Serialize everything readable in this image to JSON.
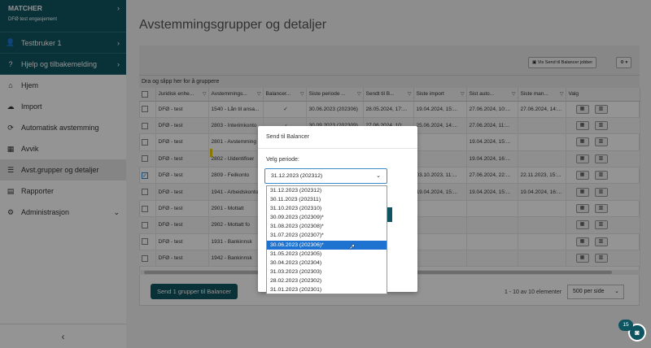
{
  "sidebar": {
    "brand_title": "MATCHER",
    "brand_subtitle": "DFØ test engasjement",
    "user": "Testbruker 1",
    "help": "Hjelp og tilbakemelding",
    "menu": [
      "Hjem",
      "Import",
      "Automatisk avstemming",
      "Avvik",
      "Avst.grupper og detaljer",
      "Rapporter",
      "Administrasjon"
    ],
    "collapse_icon": "chevron-left-icon"
  },
  "page": {
    "title": "Avstemmingsgrupper og detaljer",
    "toolbar_button": "Vis Send til Balancer jobber",
    "group_hint": "Dra og slipp her for å gruppere"
  },
  "table": {
    "headers": [
      "Juridisk enhe...",
      "Avstemmings...",
      "Balancer...",
      "Siste periode ...",
      "Sendt til B...",
      "Siste import",
      "Sist auto...",
      "Siste man...",
      "Valg"
    ],
    "rows": [
      {
        "juridisk": "DFØ - test",
        "avst": "1540 - Lån til ansa...",
        "balancer": "✓",
        "periode": "30.06.2023 (202306)",
        "sendt": "28.05.2024, 17:...",
        "import": "19.04.2024, 15:...",
        "auto": "27.06.2024, 10:...",
        "man": "27.06.2024, 14:..."
      },
      {
        "juridisk": "DFØ - test",
        "avst": "2803 - Interimkonto",
        "balancer": "✓",
        "periode": "30.09.2023 (202309)",
        "sendt": "27.06.2024, 10:...",
        "import": "25.06.2024, 14:...",
        "auto": "27.06.2024, 11:...",
        "man": ""
      },
      {
        "juridisk": "DFØ - test",
        "avst": "2801 - Avstemming",
        "balancer": "",
        "periode": "",
        "sendt": "",
        "import": "",
        "auto": "19.04.2024, 15:...",
        "man": ""
      },
      {
        "juridisk": "DFØ - test",
        "avst": "2802 - Uidentifiser",
        "balancer": "",
        "periode": "",
        "sendt": "",
        "import": "",
        "auto": "19.04.2024, 16:...",
        "man": ""
      },
      {
        "juridisk": "DFØ - test",
        "avst": "2809 - Feilkonto",
        "balancer": "",
        "periode": "",
        "sendt": "",
        "import": "03.10.2023, 11:...",
        "auto": "27.06.2024, 22:...",
        "man": "22.11.2023, 15:..."
      },
      {
        "juridisk": "DFØ - test",
        "avst": "1941 - Arbeidskonto",
        "balancer": "",
        "periode": "",
        "sendt": "",
        "import": "19.04.2024, 15:...",
        "auto": "19.04.2024, 15:...",
        "man": "19.04.2024, 16:..."
      },
      {
        "juridisk": "DFØ - test",
        "avst": "2901 - Mottatt",
        "balancer": "",
        "periode": "",
        "sendt": "",
        "import": "",
        "auto": "",
        "man": ""
      },
      {
        "juridisk": "DFØ - test",
        "avst": "2902 - Mottatt fo",
        "balancer": "",
        "periode": "",
        "sendt": "",
        "import": "",
        "auto": "",
        "man": ""
      },
      {
        "juridisk": "DFØ - test",
        "avst": "1931 - Bankinnsk",
        "balancer": "",
        "periode": "",
        "sendt": "",
        "import": "",
        "auto": "",
        "man": ""
      },
      {
        "juridisk": "DFØ - test",
        "avst": "1942 - Bankinnsk",
        "balancer": "",
        "periode": "",
        "sendt": "",
        "import": "",
        "auto": "",
        "man": ""
      }
    ]
  },
  "footer": {
    "send_button": "Send 1 grupper til Balancer",
    "pager": "1 - 10 av 10 elementer",
    "per_page": "500 per side"
  },
  "dialog": {
    "title": "Send til Balancer",
    "label": "Velg periode:",
    "selected": "31.12.2023 (202312)",
    "options": [
      "31.12.2023 (202312)",
      "30.11.2023 (202311)",
      "31.10.2023 (202310)",
      "30.09.2023 (202309)*",
      "31.08.2023 (202308)*",
      "31.07.2023 (202307)*",
      "30.06.2023 (202306)*",
      "31.05.2023 (202305)",
      "30.04.2023 (202304)",
      "31.03.2023 (202303)",
      "28.02.2023 (202302)",
      "31.01.2023 (202301)"
    ],
    "highlighted_index": 6
  },
  "fab": {
    "badge": "15",
    "icon": "assistant-logo-icon"
  },
  "colors": {
    "brand": "#0f5561",
    "highlight": "#1e73d0"
  }
}
